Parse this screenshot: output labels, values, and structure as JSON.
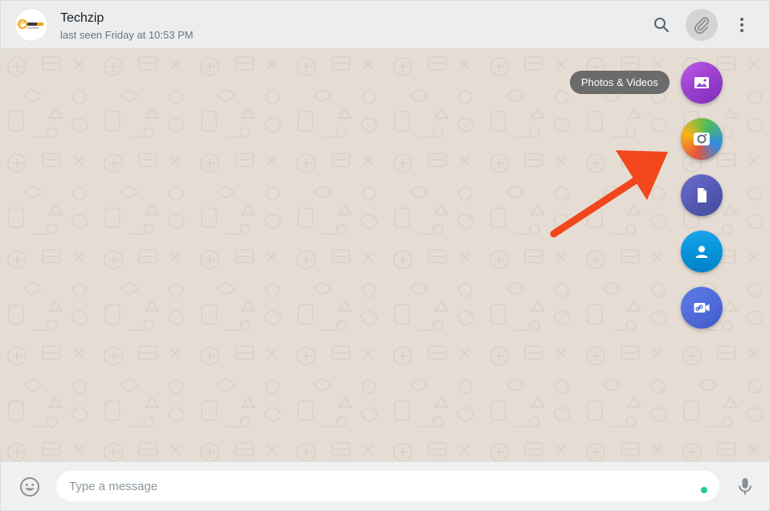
{
  "header": {
    "avatar_logo_text": "TECHZIP",
    "contact_name": "Techzip",
    "contact_status": "last seen Friday at 10:53 PM",
    "icons": [
      "search-icon",
      "paperclip-icon",
      "more-vertical-icon"
    ]
  },
  "attach_menu": {
    "tooltip": "Photos & Videos",
    "items": [
      {
        "name": "photos-videos",
        "icon": "image-icon",
        "color": "#9b3fd0"
      },
      {
        "name": "camera",
        "icon": "camera-icon",
        "color": "#e9553c"
      },
      {
        "name": "document",
        "icon": "document-icon",
        "color": "#5157ae"
      },
      {
        "name": "contact",
        "icon": "person-icon",
        "color": "#0795dc"
      },
      {
        "name": "room",
        "icon": "video-link-icon",
        "color": "#4d69d8"
      }
    ]
  },
  "annotation": {
    "arrow_color": "#f2461b"
  },
  "footer": {
    "input_placeholder": "Type a message",
    "icons": [
      "emoji-icon",
      "mic-icon"
    ]
  },
  "colors": {
    "chat_background": "#e5ddd4",
    "header_background": "#ededed",
    "footer_background": "#f0f0f0",
    "status_dot": "#1ed08f"
  }
}
